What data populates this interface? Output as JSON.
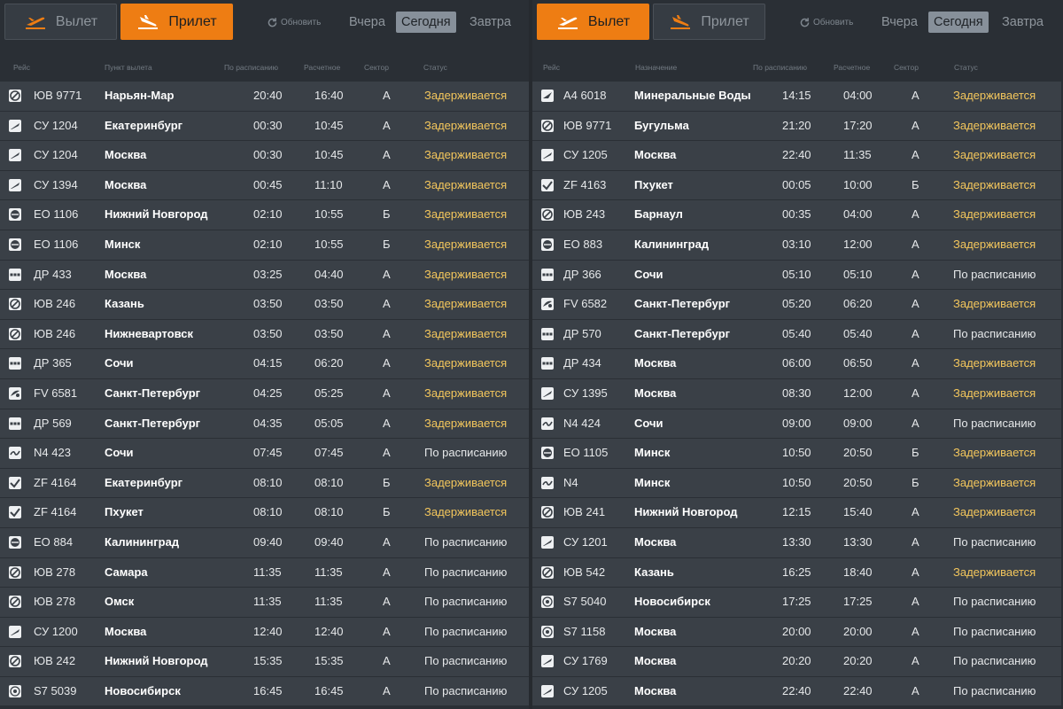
{
  "colors": {
    "accent": "#ee7d13",
    "delayed": "#f3c65c",
    "row_bg": "#3a4047",
    "page_bg": "#2a2f35"
  },
  "left": {
    "tabs": [
      {
        "label": "Вылет",
        "icon": "departure-icon",
        "active": false
      },
      {
        "label": "Прилет",
        "icon": "arrival-icon",
        "active": true
      }
    ],
    "refresh_label": "Обновить",
    "days": [
      {
        "label": "Вчера",
        "selected": false
      },
      {
        "label": "Сегодня",
        "selected": true
      },
      {
        "label": "Завтра",
        "selected": false
      }
    ],
    "headers": {
      "flight": "Рейс",
      "place": "Пункт вылета",
      "scheduled": "По расписанию",
      "estimated": "Расчетное",
      "sector": "Сектор",
      "status": "Статус"
    },
    "rows": [
      {
        "logo": "yuv-logo-icon",
        "flight": "ЮВ 9771",
        "city": "Нарьян-Мар",
        "sched": "20:40",
        "est": "16:40",
        "sector": "А",
        "status": "Задерживается",
        "delayed": true
      },
      {
        "logo": "su-logo-icon",
        "flight": "СУ 1204",
        "city": "Екатеринбург",
        "sched": "00:30",
        "est": "10:45",
        "sector": "А",
        "status": "Задерживается",
        "delayed": true
      },
      {
        "logo": "su-logo-icon",
        "flight": "СУ 1204",
        "city": "Москва",
        "sched": "00:30",
        "est": "10:45",
        "sector": "А",
        "status": "Задерживается",
        "delayed": true
      },
      {
        "logo": "su-logo-icon",
        "flight": "СУ 1394",
        "city": "Москва",
        "sched": "00:45",
        "est": "11:10",
        "sector": "А",
        "status": "Задерживается",
        "delayed": true
      },
      {
        "logo": "eo-logo-icon",
        "flight": "ЕО 1106",
        "city": "Нижний Новгород",
        "sched": "02:10",
        "est": "10:55",
        "sector": "Б",
        "status": "Задерживается",
        "delayed": true
      },
      {
        "logo": "eo-logo-icon",
        "flight": "ЕО 1106",
        "city": "Минск",
        "sched": "02:10",
        "est": "10:55",
        "sector": "Б",
        "status": "Задерживается",
        "delayed": true
      },
      {
        "logo": "dp-logo-icon",
        "flight": "ДР 433",
        "city": "Москва",
        "sched": "03:25",
        "est": "04:40",
        "sector": "А",
        "status": "Задерживается",
        "delayed": true
      },
      {
        "logo": "yuv-logo-icon",
        "flight": "ЮВ 246",
        "city": "Казань",
        "sched": "03:50",
        "est": "03:50",
        "sector": "А",
        "status": "Задерживается",
        "delayed": true
      },
      {
        "logo": "yuv-logo-icon",
        "flight": "ЮВ 246",
        "city": "Нижневартовск",
        "sched": "03:50",
        "est": "03:50",
        "sector": "А",
        "status": "Задерживается",
        "delayed": true
      },
      {
        "logo": "dp-logo-icon",
        "flight": "ДР 365",
        "city": "Сочи",
        "sched": "04:15",
        "est": "06:20",
        "sector": "А",
        "status": "Задерживается",
        "delayed": true
      },
      {
        "logo": "fv-logo-icon",
        "flight": "FV 6581",
        "city": "Санкт-Петербург",
        "sched": "04:25",
        "est": "05:25",
        "sector": "А",
        "status": "Задерживается",
        "delayed": true
      },
      {
        "logo": "dp-logo-icon",
        "flight": "ДР 569",
        "city": "Санкт-Петербург",
        "sched": "04:35",
        "est": "05:05",
        "sector": "А",
        "status": "Задерживается",
        "delayed": true
      },
      {
        "logo": "n4-logo-icon",
        "flight": "N4 423",
        "city": "Сочи",
        "sched": "07:45",
        "est": "07:45",
        "sector": "А",
        "status": "По расписанию",
        "delayed": false
      },
      {
        "logo": "zf-logo-icon",
        "flight": "ZF 4164",
        "city": "Екатеринбург",
        "sched": "08:10",
        "est": "08:10",
        "sector": "Б",
        "status": "Задерживается",
        "delayed": true
      },
      {
        "logo": "zf-logo-icon",
        "flight": "ZF 4164",
        "city": "Пхукет",
        "sched": "08:10",
        "est": "08:10",
        "sector": "Б",
        "status": "Задерживается",
        "delayed": true
      },
      {
        "logo": "eo-logo-icon",
        "flight": "ЕО 884",
        "city": "Калининград",
        "sched": "09:40",
        "est": "09:40",
        "sector": "А",
        "status": "По расписанию",
        "delayed": false
      },
      {
        "logo": "yuv-logo-icon",
        "flight": "ЮВ 278",
        "city": "Самара",
        "sched": "11:35",
        "est": "11:35",
        "sector": "А",
        "status": "По расписанию",
        "delayed": false
      },
      {
        "logo": "yuv-logo-icon",
        "flight": "ЮВ 278",
        "city": "Омск",
        "sched": "11:35",
        "est": "11:35",
        "sector": "А",
        "status": "По расписанию",
        "delayed": false
      },
      {
        "logo": "su-logo-icon",
        "flight": "СУ 1200",
        "city": "Москва",
        "sched": "12:40",
        "est": "12:40",
        "sector": "А",
        "status": "По расписанию",
        "delayed": false
      },
      {
        "logo": "yuv-logo-icon",
        "flight": "ЮВ 242",
        "city": "Нижний Новгород",
        "sched": "15:35",
        "est": "15:35",
        "sector": "А",
        "status": "По расписанию",
        "delayed": false
      },
      {
        "logo": "s7-logo-icon",
        "flight": "S7 5039",
        "city": "Новосибирск",
        "sched": "16:45",
        "est": "16:45",
        "sector": "А",
        "status": "По расписанию",
        "delayed": false
      }
    ]
  },
  "right": {
    "tabs": [
      {
        "label": "Вылет",
        "icon": "departure-icon",
        "active": true
      },
      {
        "label": "Прилет",
        "icon": "arrival-icon",
        "active": false
      }
    ],
    "refresh_label": "Обновить",
    "days": [
      {
        "label": "Вчера",
        "selected": false
      },
      {
        "label": "Сегодня",
        "selected": true
      },
      {
        "label": "Завтра",
        "selected": false
      }
    ],
    "headers": {
      "flight": "Рейс",
      "place": "Назначение",
      "scheduled": "По расписанию",
      "estimated": "Расчетное",
      "sector": "Сектор",
      "status": "Статус"
    },
    "rows": [
      {
        "logo": "a4-logo-icon",
        "flight": "А4 6018",
        "city": "Минеральные Воды",
        "sched": "14:15",
        "est": "04:00",
        "sector": "А",
        "status": "Задерживается",
        "delayed": true
      },
      {
        "logo": "yuv-logo-icon",
        "flight": "ЮВ 9771",
        "city": "Бугульма",
        "sched": "21:20",
        "est": "17:20",
        "sector": "А",
        "status": "Задерживается",
        "delayed": true
      },
      {
        "logo": "su-logo-icon",
        "flight": "СУ 1205",
        "city": "Москва",
        "sched": "22:40",
        "est": "11:35",
        "sector": "А",
        "status": "Задерживается",
        "delayed": true
      },
      {
        "logo": "zf-logo-icon",
        "flight": "ZF 4163",
        "city": "Пхукет",
        "sched": "00:05",
        "est": "10:00",
        "sector": "Б",
        "status": "Задерживается",
        "delayed": true
      },
      {
        "logo": "yuv-logo-icon",
        "flight": "ЮВ 243",
        "city": "Барнаул",
        "sched": "00:35",
        "est": "04:00",
        "sector": "А",
        "status": "Задерживается",
        "delayed": true
      },
      {
        "logo": "eo-logo-icon",
        "flight": "ЕО 883",
        "city": "Калининград",
        "sched": "03:10",
        "est": "12:00",
        "sector": "А",
        "status": "Задерживается",
        "delayed": true
      },
      {
        "logo": "dp-logo-icon",
        "flight": "ДР 366",
        "city": "Сочи",
        "sched": "05:10",
        "est": "05:10",
        "sector": "А",
        "status": "По расписанию",
        "delayed": false
      },
      {
        "logo": "fv-logo-icon",
        "flight": "FV 6582",
        "city": "Санкт-Петербург",
        "sched": "05:20",
        "est": "06:20",
        "sector": "А",
        "status": "Задерживается",
        "delayed": true
      },
      {
        "logo": "dp-logo-icon",
        "flight": "ДР 570",
        "city": "Санкт-Петербург",
        "sched": "05:40",
        "est": "05:40",
        "sector": "А",
        "status": "По расписанию",
        "delayed": false
      },
      {
        "logo": "dp-logo-icon",
        "flight": "ДР 434",
        "city": "Москва",
        "sched": "06:00",
        "est": "06:50",
        "sector": "А",
        "status": "Задерживается",
        "delayed": true
      },
      {
        "logo": "su-logo-icon",
        "flight": "СУ 1395",
        "city": "Москва",
        "sched": "08:30",
        "est": "12:00",
        "sector": "А",
        "status": "Задерживается",
        "delayed": true
      },
      {
        "logo": "n4-logo-icon",
        "flight": "N4 424",
        "city": "Сочи",
        "sched": "09:00",
        "est": "09:00",
        "sector": "А",
        "status": "По расписанию",
        "delayed": false
      },
      {
        "logo": "eo-logo-icon",
        "flight": "ЕО 1105",
        "city": "Минск",
        "sched": "10:50",
        "est": "20:50",
        "sector": "Б",
        "status": "Задерживается",
        "delayed": true
      },
      {
        "logo": "n4-logo-icon",
        "flight": "N4",
        "city": "Минск",
        "sched": "10:50",
        "est": "20:50",
        "sector": "Б",
        "status": "Задерживается",
        "delayed": true
      },
      {
        "logo": "yuv-logo-icon",
        "flight": "ЮВ 241",
        "city": "Нижний Новгород",
        "sched": "12:15",
        "est": "15:40",
        "sector": "А",
        "status": "Задерживается",
        "delayed": true
      },
      {
        "logo": "su-logo-icon",
        "flight": "СУ 1201",
        "city": "Москва",
        "sched": "13:30",
        "est": "13:30",
        "sector": "А",
        "status": "По расписанию",
        "delayed": false
      },
      {
        "logo": "yuv-logo-icon",
        "flight": "ЮВ 542",
        "city": "Казань",
        "sched": "16:25",
        "est": "18:40",
        "sector": "А",
        "status": "Задерживается",
        "delayed": true
      },
      {
        "logo": "s7-logo-icon",
        "flight": "S7 5040",
        "city": "Новосибирск",
        "sched": "17:25",
        "est": "17:25",
        "sector": "А",
        "status": "По расписанию",
        "delayed": false
      },
      {
        "logo": "s7-logo-icon",
        "flight": "S7 1158",
        "city": "Москва",
        "sched": "20:00",
        "est": "20:00",
        "sector": "А",
        "status": "По расписанию",
        "delayed": false
      },
      {
        "logo": "su-logo-icon",
        "flight": "СУ 1769",
        "city": "Москва",
        "sched": "20:20",
        "est": "20:20",
        "sector": "А",
        "status": "По расписанию",
        "delayed": false
      },
      {
        "logo": "su-logo-icon",
        "flight": "СУ 1205",
        "city": "Москва",
        "sched": "22:40",
        "est": "22:40",
        "sector": "А",
        "status": "По расписанию",
        "delayed": false
      }
    ]
  }
}
